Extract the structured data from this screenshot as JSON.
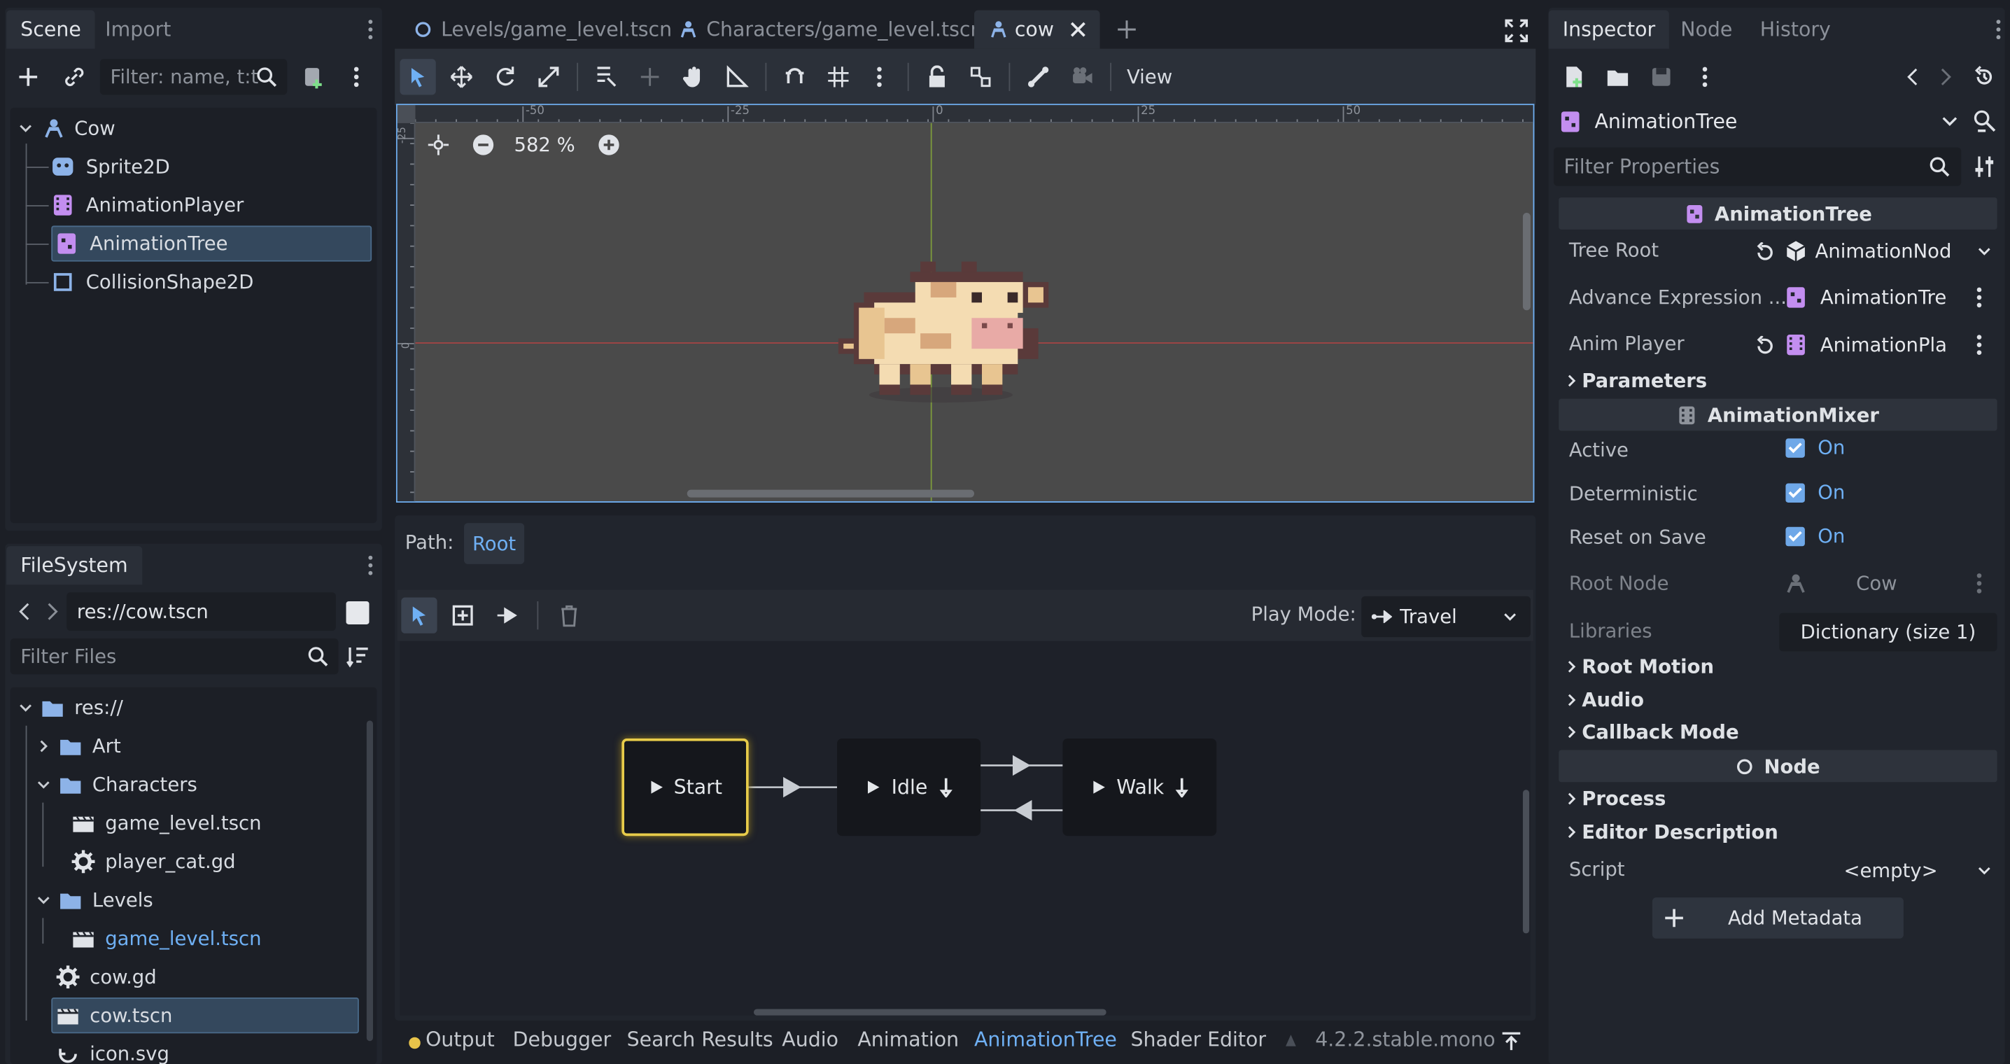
{
  "scene_dock": {
    "tabs": [
      "Scene",
      "Import"
    ],
    "filter_placeholder": "Filter: name, t:t",
    "tree": [
      {
        "label": "Cow",
        "icon": "character-body-icon"
      },
      {
        "label": "Sprite2D",
        "icon": "sprite-icon"
      },
      {
        "label": "AnimationPlayer",
        "icon": "animation-player-icon"
      },
      {
        "label": "AnimationTree",
        "icon": "animation-tree-icon",
        "selected": true
      },
      {
        "label": "CollisionShape2D",
        "icon": "collision-shape-icon"
      }
    ]
  },
  "filesystem": {
    "tab": "FileSystem",
    "path": "res://cow.tscn",
    "filter_placeholder": "Filter Files",
    "items": [
      {
        "label": "res://",
        "icon": "folder-icon"
      },
      {
        "label": "Art",
        "icon": "folder-icon"
      },
      {
        "label": "Characters",
        "icon": "folder-icon"
      },
      {
        "label": "game_level.tscn",
        "icon": "scene-file-icon"
      },
      {
        "label": "player_cat.gd",
        "icon": "gear-icon"
      },
      {
        "label": "Levels",
        "icon": "folder-icon"
      },
      {
        "label": "game_level.tscn",
        "icon": "scene-file-icon",
        "highlight": true
      },
      {
        "label": "cow.gd",
        "icon": "gear-icon"
      },
      {
        "label": "cow.tscn",
        "icon": "scene-file-icon",
        "selected": true
      },
      {
        "label": "icon.svg",
        "icon": "image-file-icon"
      }
    ]
  },
  "editor_tabs": [
    "Levels/game_level.tscn",
    "Characters/game_level.tscn",
    "cow"
  ],
  "toolbar": {
    "view_label": "View"
  },
  "viewport": {
    "zoom": "582 %",
    "ruler_ticks": [
      "-50",
      "-25",
      "0",
      "25",
      "50"
    ],
    "vruler_ticks": [
      "-25",
      "0"
    ]
  },
  "anim_tree_editor": {
    "path_label": "Path:",
    "path_root": "Root",
    "play_mode_label": "Play Mode:",
    "play_mode_value": "Travel",
    "nodes": {
      "start": "Start",
      "idle": "Idle",
      "walk": "Walk"
    }
  },
  "bottom_panel": {
    "tabs": [
      "Output",
      "Debugger",
      "Search Results",
      "Audio",
      "Animation",
      "AnimationTree",
      "Shader Editor"
    ],
    "active_tab": "AnimationTree",
    "version": "4.2.2.stable.mono"
  },
  "inspector": {
    "tabs": [
      "Inspector",
      "Node",
      "History"
    ],
    "object": "AnimationTree",
    "filter_placeholder": "Filter Properties",
    "section_animation_tree": "AnimationTree",
    "tree_root_label": "Tree Root",
    "tree_root_value": "AnimationNod",
    "adv_expr_label": "Advance Expression ...",
    "adv_expr_value": "AnimationTre",
    "anim_player_label": "Anim Player",
    "anim_player_value": "AnimationPla",
    "parameters": "Parameters",
    "section_mixer": "AnimationMixer",
    "active_label": "Active",
    "active_value": "On",
    "deterministic_label": "Deterministic",
    "deterministic_value": "On",
    "reset_label": "Reset on Save",
    "reset_value": "On",
    "root_node_label": "Root Node",
    "root_node_value": "Cow",
    "libraries_label": "Libraries",
    "libraries_value": "Dictionary (size 1)",
    "root_motion": "Root Motion",
    "audio": "Audio",
    "callback_mode": "Callback Mode",
    "section_node": "Node",
    "process": "Process",
    "editor_description": "Editor Description",
    "script_label": "Script",
    "script_value": "<empty>",
    "add_metadata": "Add Metadata"
  }
}
